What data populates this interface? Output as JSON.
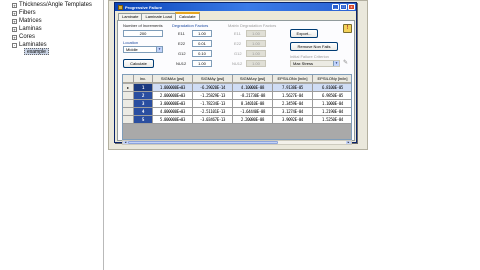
{
  "tree": {
    "items": [
      {
        "label": "Thickness/Angle Templates",
        "expander": "+"
      },
      {
        "label": "Fibers",
        "expander": "+"
      },
      {
        "label": "Matrices",
        "expander": "+"
      },
      {
        "label": "Laminas",
        "expander": "+"
      },
      {
        "label": "Cores",
        "expander": "+"
      },
      {
        "label": "Laminates",
        "expander": "-"
      }
    ],
    "selected_child": "example"
  },
  "window": {
    "title": "Progressive Failure",
    "minimize": "_",
    "maximize": "□",
    "close": "x"
  },
  "tabs": [
    {
      "label": "Laminate",
      "active": false
    },
    {
      "label": "Laminate Load",
      "active": false
    },
    {
      "label": "Calculate",
      "active": true
    }
  ],
  "form": {
    "increments_label": "Number of Increments",
    "increments_value": "200",
    "location_label": "Location",
    "location_value": "Middle",
    "calculate_button": "Calculate",
    "degradation_label": "Degradation Factors",
    "degradation_fields": [
      {
        "label": "E11",
        "value": "1.00"
      },
      {
        "label": "E22",
        "value": "0.01"
      },
      {
        "label": "G12",
        "value": "0.10"
      },
      {
        "label": "NU12",
        "value": "1.00"
      }
    ],
    "matrix_label": "Matrix Degradation Factors",
    "matrix_fields": [
      {
        "label": "E11",
        "value": "1.00"
      },
      {
        "label": "E22",
        "value": "1.00"
      },
      {
        "label": "G12",
        "value": "1.00"
      },
      {
        "label": "NU12",
        "value": "1.00"
      }
    ],
    "export_button": "Export...",
    "remove_button": "Remove Non Fails",
    "criterion_label": "Initial Failure Criterion",
    "criterion_value": "Max Stress"
  },
  "grid": {
    "headers": [
      "Inc.",
      "SIGMAx [psi]",
      "SIGMAy [psi]",
      "SIGMAxy [psi]",
      "EPSILONx [in/in]",
      "EPSILONy [in/in]"
    ],
    "rows": [
      [
        "1",
        "1.000000E+03",
        "-6.29020E-14",
        "4.10000E-08",
        "7.9138E-05",
        "6.8100E-05"
      ],
      [
        "2",
        "2.000000E+03",
        "-1.25829E-13",
        "-8.21730E-08",
        "1.5627E-04",
        "6.9850E-05"
      ],
      [
        "3",
        "3.000000E+03",
        "-1.78234E-13",
        "8.34010E-08",
        "2.3459E-04",
        "1.1000E-04"
      ],
      [
        "4",
        "4.000000E+03",
        "-2.51101E-13",
        "-1.64440E-08",
        "3.1274E-04",
        "1.2190E-04"
      ],
      [
        "5",
        "5.000000E+03",
        "-3.03467E-13",
        "2.20080E-08",
        "3.9092E-04",
        "1.5250E-04"
      ]
    ],
    "current_row_marker": "▸"
  }
}
